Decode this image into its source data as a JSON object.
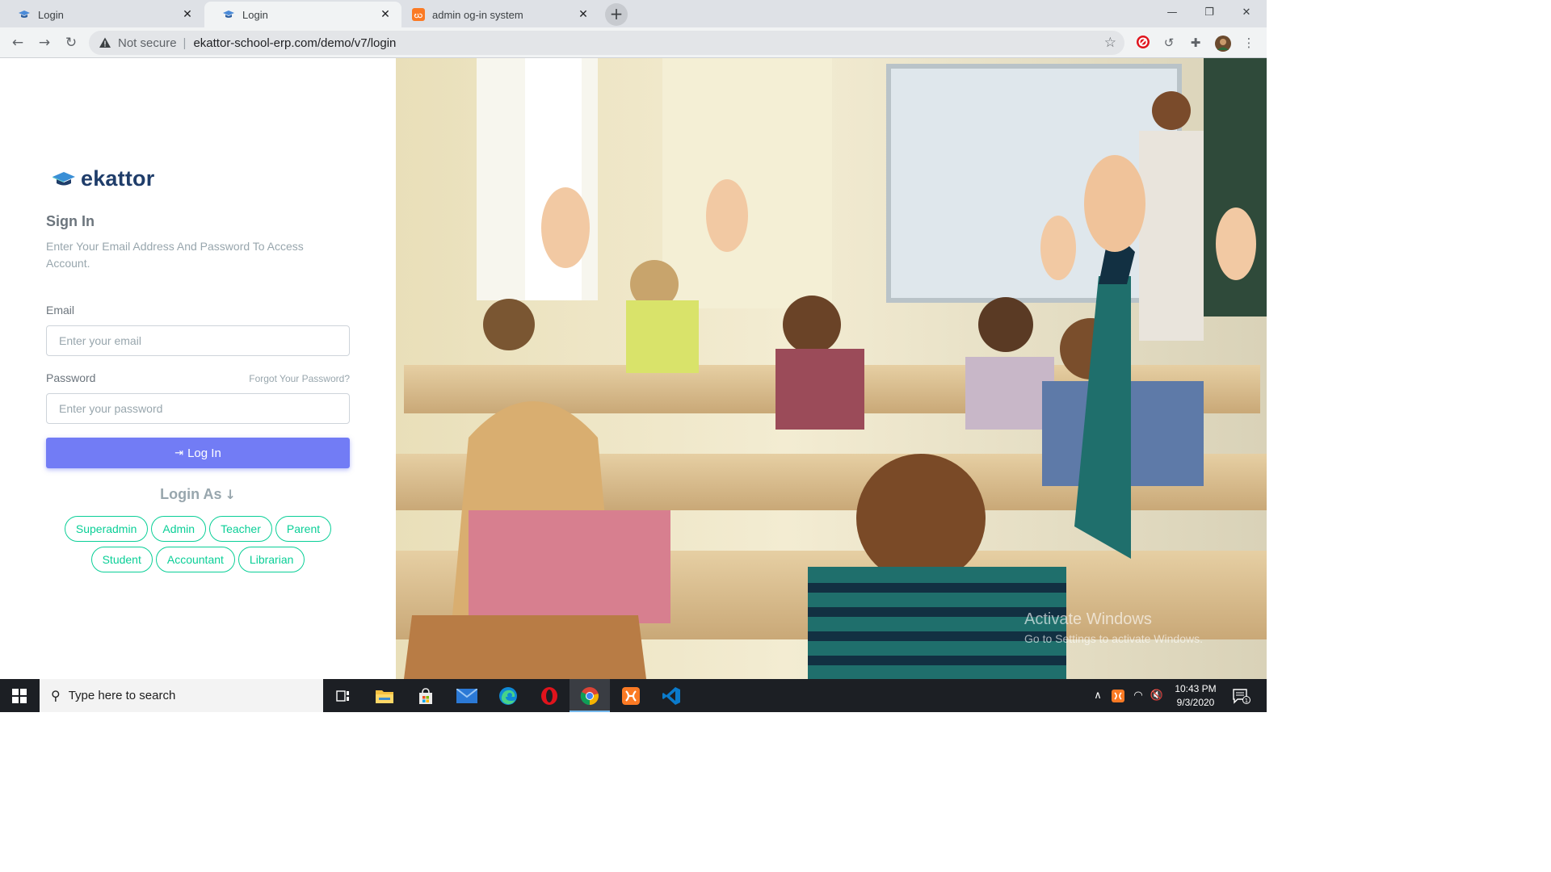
{
  "browser": {
    "tabs": [
      {
        "title": "Login",
        "favicon": "ekattor-cap-icon",
        "active": false
      },
      {
        "title": "Login",
        "favicon": "ekattor-cap-icon",
        "active": true
      },
      {
        "title": "admin og-in system",
        "favicon": "xampp-icon",
        "active": false
      }
    ],
    "close_glyph": "✕",
    "new_tab_glyph": "+",
    "window_controls": {
      "minimize": "—",
      "restore": "❐",
      "close": "✕"
    },
    "nav": {
      "back": "←",
      "forward": "→",
      "reload": "↻"
    },
    "omnibox": {
      "security_label": "Not secure",
      "separator": "|",
      "url": "ekattor-school-erp.com/demo/v7/login",
      "bookmark_glyph": "☆"
    },
    "extensions": {
      "history_glyph": "↺",
      "puzzle_glyph": "✚",
      "menu_glyph": "⋮"
    }
  },
  "login": {
    "logo_text": "ekattor",
    "title": "Sign In",
    "description": "Enter Your Email Address And Password To Access Account.",
    "email_label": "Email",
    "email_placeholder": "Enter your email",
    "password_label": "Password",
    "forgot_link": "Forgot Your Password?",
    "password_placeholder": "Enter your password",
    "login_icon_glyph": "⇥",
    "login_button": "Log In",
    "login_as_label": "Login As",
    "login_as_arrow": "↓",
    "roles_row1": [
      "Superadmin",
      "Admin",
      "Teacher",
      "Parent"
    ],
    "roles_row2": [
      "Student",
      "Accountant",
      "Librarian"
    ]
  },
  "watermark": {
    "line1": "Activate Windows",
    "line2": "Go to Settings to activate Windows."
  },
  "taskbar": {
    "search_placeholder": "Type here to search",
    "search_glyph": "⚲",
    "apps": [
      "task-view",
      "file-explorer",
      "microsoft-store",
      "mail",
      "edge",
      "opera",
      "chrome",
      "xampp",
      "vscode"
    ],
    "active_app": "chrome",
    "tray": {
      "chevron": "∧",
      "wifi": "◠",
      "volume": "🔇",
      "notification_count": "1"
    },
    "time": "10:43 PM",
    "date": "9/3/2020"
  },
  "colors": {
    "accent": "#727cf5",
    "role_outline": "#0acf97",
    "logo_text": "#1f3d6a"
  }
}
